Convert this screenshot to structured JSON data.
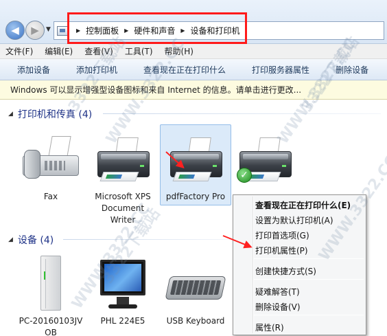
{
  "address_bar": {
    "breadcrumbs": [
      "控制面板",
      "硬件和声音",
      "设备和打印机"
    ]
  },
  "menu": {
    "items": [
      "文件(F)",
      "编辑(E)",
      "查看(V)",
      "工具(T)",
      "帮助(H)"
    ]
  },
  "command_bar": {
    "items": [
      "添加设备",
      "添加打印机",
      "查看现在正在打印什么",
      "打印服务器属性",
      "删除设备"
    ]
  },
  "info_bar": {
    "text": "Windows 可以显示增强型设备图标和来自 Internet 的信息。请单击进行更改..."
  },
  "printers": {
    "header": "打印机和传真 (4)",
    "items": [
      {
        "label": "Fax",
        "icon": "fax-icon"
      },
      {
        "label": "Microsoft XPS Document Writer",
        "icon": "printer-icon"
      },
      {
        "label": "pdfFactory Pro",
        "icon": "printer-icon",
        "selected": true
      },
      {
        "label": "",
        "icon": "printer-icon",
        "default": true
      }
    ]
  },
  "devices": {
    "header": "设备 (4)",
    "items": [
      {
        "label": "PC-20160103JV OB",
        "icon": "pc-tower-icon"
      },
      {
        "label": "PHL 224E5",
        "icon": "monitor-icon"
      },
      {
        "label": "USB Keyboard",
        "icon": "keyboard-icon"
      }
    ]
  },
  "context_menu": {
    "items": [
      {
        "label": "查看现在正在打印什么(E)",
        "bold": true
      },
      {
        "label": "设置为默认打印机(A)"
      },
      {
        "label": "打印首选项(G)"
      },
      {
        "label": "打印机属性(P)"
      },
      {
        "label": "创建快捷方式(S)"
      },
      {
        "label": "疑难解答(T)"
      },
      {
        "label": "删除设备(V)"
      },
      {
        "label": "属性(R)"
      }
    ]
  },
  "watermark": {
    "text1": "3322下载站",
    "text2": "WWW.3322.CC"
  },
  "colors": {
    "highlight_border": "#ff1a1a",
    "arrow": "#ff2020",
    "group_header": "#1e3287",
    "info_bar_bg": "#fdfbe0"
  }
}
